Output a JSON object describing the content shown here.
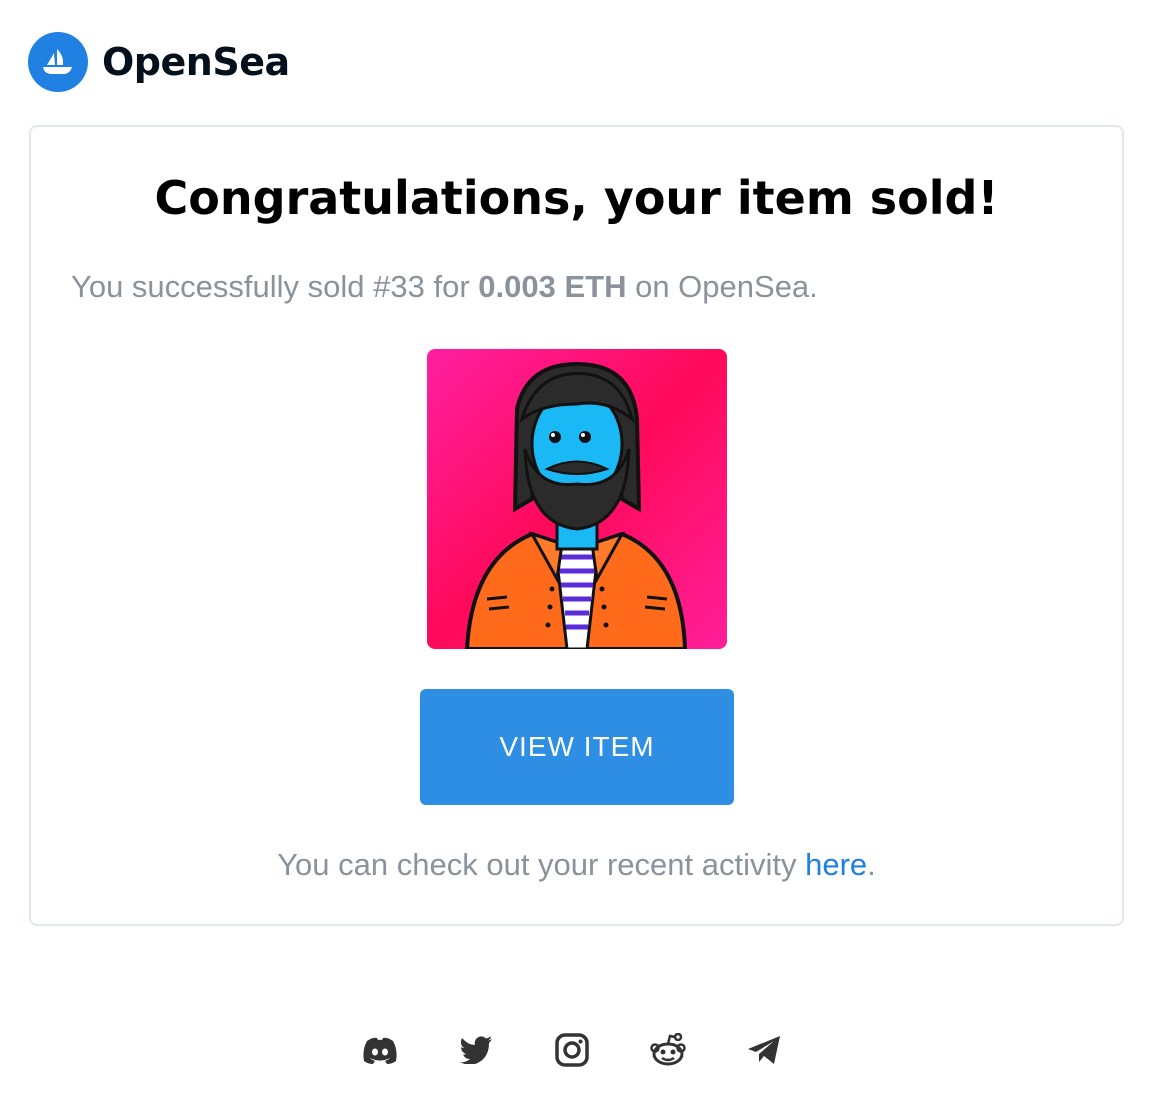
{
  "brand": {
    "name": "OpenSea",
    "color": "#2081e2",
    "logo_icon": "sailboat-icon"
  },
  "email": {
    "title": "Congratulations, your item sold!",
    "sold_prefix": "You successfully sold #33 for ",
    "price": "0.003 ETH",
    "sold_suffix": " on OpenSea.",
    "item_image_alt": "NFT #33 bearded character in orange jacket",
    "button_label": "VIEW ITEM",
    "activity_prefix": "You can check out your recent activity ",
    "activity_link": "here",
    "activity_suffix": "."
  },
  "footer": {
    "socials": [
      {
        "name": "discord-icon"
      },
      {
        "name": "twitter-icon"
      },
      {
        "name": "instagram-icon"
      },
      {
        "name": "reddit-icon"
      },
      {
        "name": "telegram-icon"
      }
    ]
  },
  "colors": {
    "accent": "#2081e2",
    "button": "#2e8ee3",
    "muted_text": "#8a939b",
    "nft_background": "#ff1a7a",
    "jacket": "#ff6b1a",
    "face": "#1ab8f5"
  }
}
